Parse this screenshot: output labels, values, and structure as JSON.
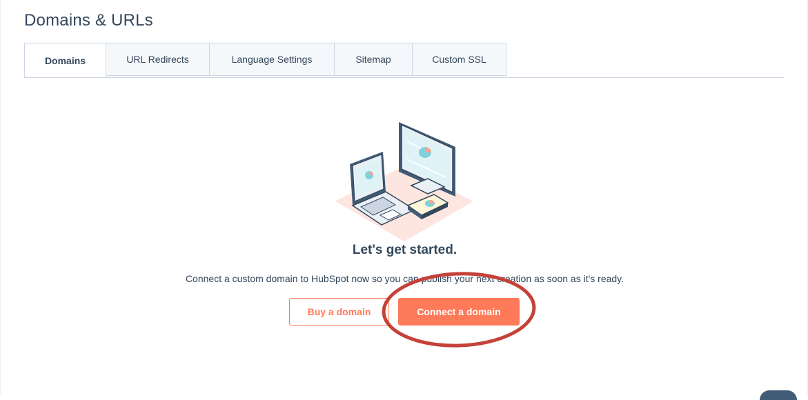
{
  "page": {
    "title": "Domains & URLs"
  },
  "tabs": [
    {
      "label": "Domains",
      "active": true
    },
    {
      "label": "URL Redirects",
      "active": false
    },
    {
      "label": "Language Settings",
      "active": false
    },
    {
      "label": "Sitemap",
      "active": false
    },
    {
      "label": "Custom SSL",
      "active": false
    }
  ],
  "empty_state": {
    "illustration": "devices-illustration",
    "headline": "Let's get started.",
    "description": "Connect a custom domain to HubSpot now so you can publish your next creation as soon as it's ready.",
    "buy_label": "Buy a domain",
    "connect_label": "Connect a domain"
  },
  "colors": {
    "accent": "#ff7a59",
    "text": "#33475b",
    "tab_border": "#cbd6e2",
    "tab_inactive_bg": "#f5f8fa",
    "annotation_ring": "#d9534a"
  }
}
